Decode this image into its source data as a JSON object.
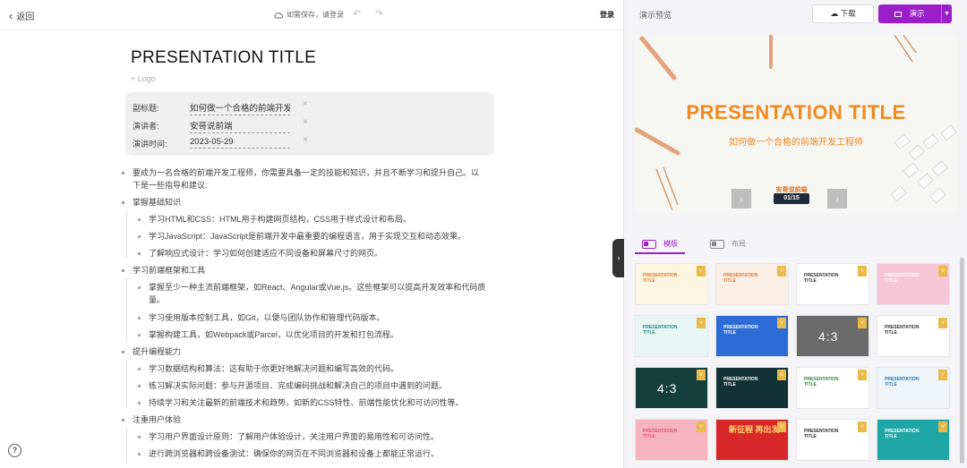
{
  "header": {
    "back_label": "返回",
    "save_status": "如需保存，请登录",
    "login_label": "登录"
  },
  "document": {
    "title": "PRESENTATION TITLE",
    "logo_placeholder": "+ Logo",
    "meta": [
      {
        "key": "副标题:",
        "value": "如何做一个合格的前端开发工"
      },
      {
        "key": "演讲者:",
        "value": "安哥说前端"
      },
      {
        "key": "演讲时间:",
        "value": "2023-05-29"
      }
    ],
    "intro": "要成为一名合格的前端开发工程师，你需要具备一定的技能和知识，并且不断学习和提升自己。以下是一些指导和建议:",
    "sections": [
      {
        "heading": "掌握基础知识",
        "items": [
          "学习HTML和CSS：HTML用于构建网页结构，CSS用于样式设计和布局。",
          "学习JavaScript：JavaScript是前端开发中最重要的编程语言，用于实现交互和动态效果。",
          "了解响应式设计：学习如何创建适应不同设备和屏幕尺寸的网页。"
        ]
      },
      {
        "heading": "学习前端框架和工具",
        "items": [
          "掌握至少一种主流前端框架，如React、Angular或Vue.js。这些框架可以提高开发效率和代码质量。",
          "学习使用版本控制工具，如Git，以便与团队协作和管理代码版本。",
          "掌握构建工具，如Webpack或Parcel，以优化项目的开发和打包流程。"
        ]
      },
      {
        "heading": "提升编程能力",
        "items": [
          "学习数据结构和算法：这有助于你更好地解决问题和编写高效的代码。",
          "练习解决实际问题：参与开源项目、完成编码挑战和解决自己的项目中遇到的问题。",
          "持续学习和关注最新的前端技术和趋势，如新的CSS特性、前端性能优化和可访问性等。"
        ]
      },
      {
        "heading": "注重用户体验",
        "items": [
          "学习用户界面设计原则：了解用户体验设计，关注用户界面的易用性和可访问性。",
          "进行跨浏览器和跨设备测试：确保你的网页在不同浏览器和设备上都能正常运行。"
        ]
      }
    ]
  },
  "right_panel": {
    "title": "演示预览",
    "download_label": "下载",
    "present_label": "演示",
    "preview": {
      "title": "PRESENTATION TITLE",
      "subtitle": "如何做一个合格的前端开发工程师",
      "author": "安哥说前端",
      "counter": "01/15"
    },
    "tabs": [
      {
        "label": "模版",
        "active": true
      },
      {
        "label": "布局",
        "active": false
      }
    ],
    "thumbnails": [
      {
        "text": "PRESENTATION TITLE",
        "bg": "#fdf6e3",
        "color": "#e07a2e"
      },
      {
        "text": "PRESENTATION TITLE",
        "bg": "#fbefe6",
        "color": "#e07a2e"
      },
      {
        "text": "PRESENTATION TITLE",
        "bg": "#ffffff",
        "color": "#333333"
      },
      {
        "text": "PRESENTATION TITLE",
        "bg": "#f7c6d6",
        "color": "#ffffff"
      },
      {
        "text": "PRESENTATION TITLE",
        "bg": "#e8f6f5",
        "color": "#1e8c8c"
      },
      {
        "text": "PRESENTATION TITLE",
        "bg": "#2d6bd6",
        "color": "#ffffff"
      },
      {
        "text": "4:3",
        "bg": "#6b6b6b",
        "color": "#ffffff"
      },
      {
        "text": "PRESENTATION TITLE",
        "bg": "#ffffff",
        "color": "#333333"
      },
      {
        "text": "4:3",
        "bg": "#143f3c",
        "color": "#ffffff"
      },
      {
        "text": "PRESENTATION TITLE",
        "bg": "#133238",
        "color": "#ffffff"
      },
      {
        "text": "PRESENTATION TITLE",
        "bg": "#ffffff",
        "color": "#2e8b3a"
      },
      {
        "text": "PRESENTATION TITLE",
        "bg": "#eef4f8",
        "color": "#2b7bbd"
      },
      {
        "text": "PRESENTATION TITLE",
        "bg": "#f6b3c0",
        "color": "#e0566e"
      },
      {
        "text": "新征程 再出发",
        "bg": "#d8282a",
        "color": "#ffd66b"
      },
      {
        "text": "PRESENTATION TITLE",
        "bg": "#ffffff",
        "color": "#2a2a2a"
      },
      {
        "text": "PRESENTATION TITLE",
        "bg": "#1fa6a6",
        "color": "#ffffff"
      }
    ]
  }
}
